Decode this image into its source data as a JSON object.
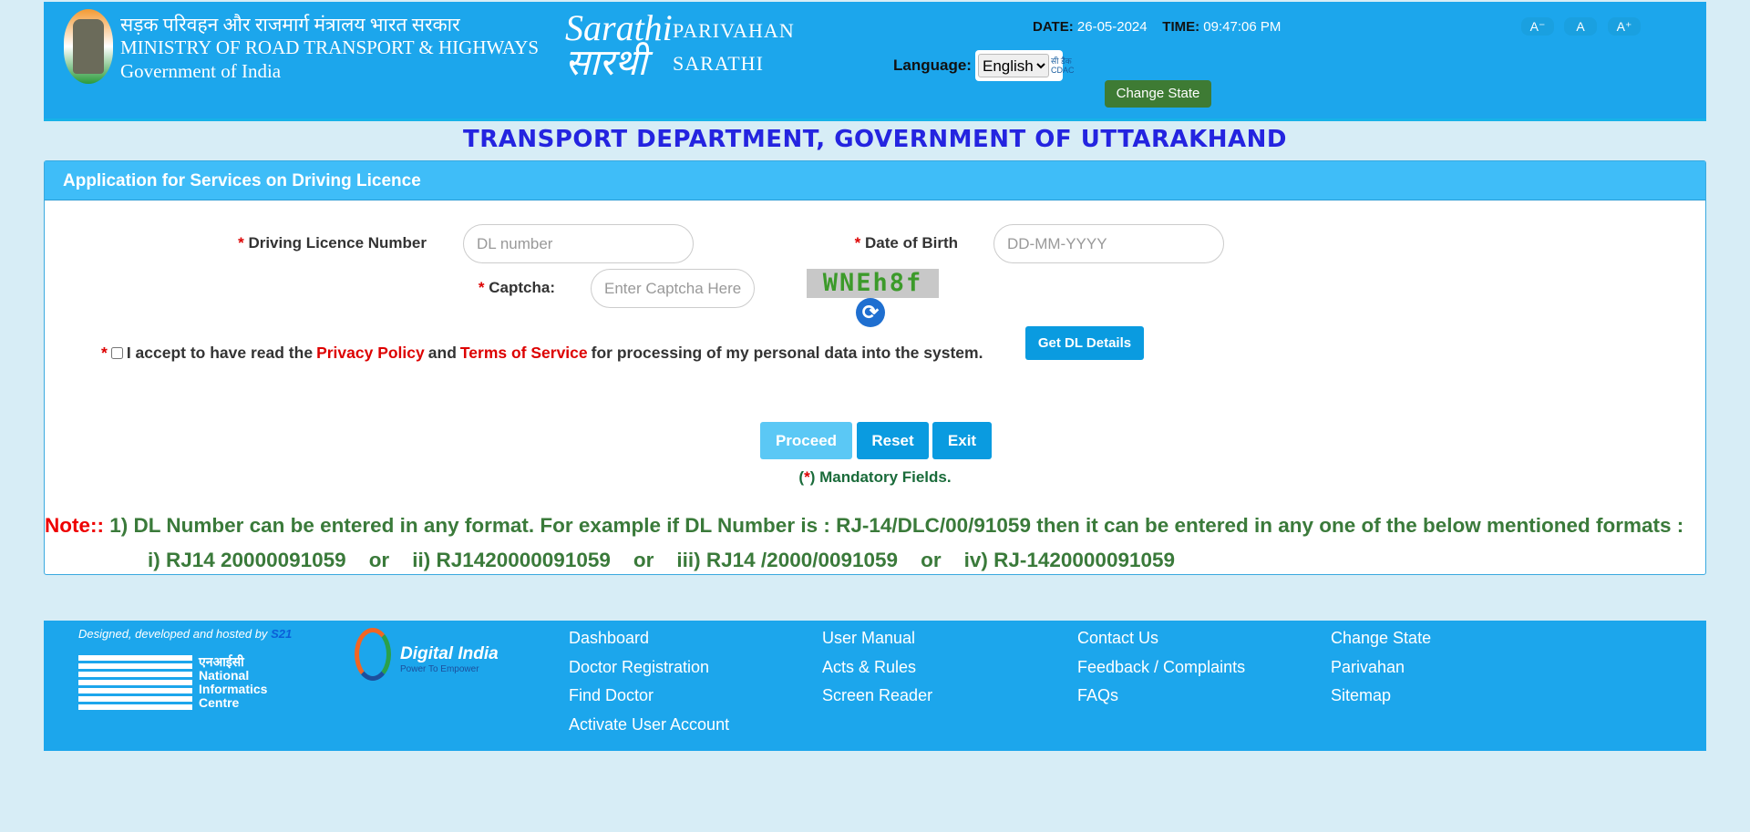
{
  "header": {
    "ministry_hindi": "सड़क परिवहन और राजमार्ग मंत्रालय भारत सरकार",
    "ministry_english": "MINISTRY OF ROAD TRANSPORT & HIGHWAYS",
    "government": "Government of India",
    "logo_text": "Sarathi",
    "logo_hindi": "सारथी",
    "parivahan": "PARIVAHAN",
    "sarathi": "SARATHI",
    "date_label": "DATE:",
    "date": "26-05-2024",
    "time_label": "TIME:",
    "time": "09:47:06 PM",
    "font_buttons": [
      "A⁻",
      "A",
      "A⁺"
    ],
    "language_label": "Language:",
    "language_selected": "English",
    "cdac_logo": "सी डैक CDAC",
    "change_state": "Change State"
  },
  "page_title": "TRANSPORT DEPARTMENT, GOVERNMENT OF UTTARAKHAND",
  "panel": {
    "title": "Application for Services on Driving Licence",
    "required_mark": "*",
    "dl_label": "Driving Licence Number",
    "dl_placeholder": "DL number",
    "dob_label": "Date of Birth",
    "dob_placeholder": "DD-MM-YYYY",
    "captcha_label": "Captcha:",
    "captcha_placeholder": "Enter Captcha Here",
    "captcha_text": "WNEh8f",
    "accept_pre": "I accept to have read the",
    "privacy": "Privacy Policy",
    "and": "and",
    "terms": "Terms of Service",
    "accept_post": "for processing of my personal data into the system.",
    "get_dl": "Get DL Details",
    "proceed": "Proceed",
    "reset": "Reset",
    "exit": "Exit",
    "mandatory_open": "(",
    "mandatory_close": ") Mandatory Fields.",
    "note_label": "Note::",
    "note_line1": " 1) DL Number can be entered in any format. For example if DL Number is : RJ-14/DLC/00/91059 then it can be entered in any one of the below mentioned formats :",
    "note_line2": "i) RJ14 20000091059    or    ii) RJ1420000091059    or    iii) RJ14 /2000/0091059    or    iv) RJ-1420000091059"
  },
  "footer": {
    "designed_by": "Designed, developed and hosted by",
    "designed_org": "S21",
    "nic_logo": "NIC एनआईसी National Informatics Centre",
    "digital_india": "Digital India",
    "digital_india_tag": "Power To Empower",
    "links": [
      [
        "Dashboard",
        "Doctor Registration",
        "Find Doctor",
        "Activate User Account"
      ],
      [
        "User Manual",
        "Acts & Rules",
        "Screen Reader"
      ],
      [
        "Contact Us",
        "Feedback / Complaints",
        "FAQs"
      ],
      [
        "Change State",
        "Parivahan",
        "Sitemap"
      ]
    ]
  },
  "colors": {
    "header_bg": "#1ca6ec",
    "panel_header": "#3fbdf8",
    "title": "#2424e0",
    "note_green": "#3a7a3a",
    "change_state": "#3e7b34"
  }
}
